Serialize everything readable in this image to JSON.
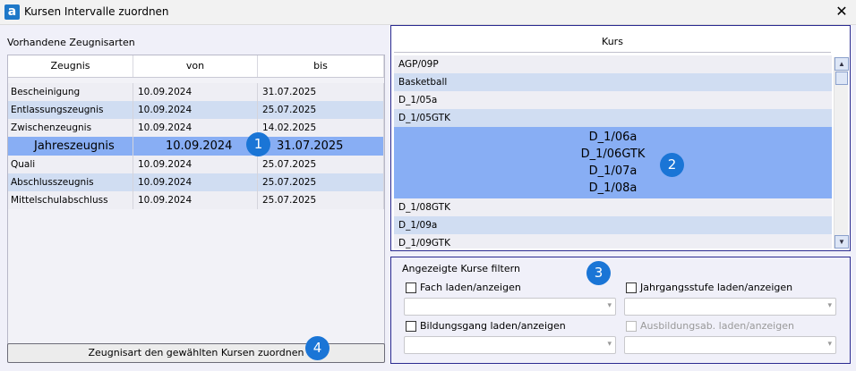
{
  "window": {
    "title": "Kursen Intervalle zuordnen",
    "icon_letter": "a"
  },
  "left": {
    "label": "Vorhandene Zeugnisarten",
    "columns": [
      "Zeugnis",
      "von",
      "bis"
    ],
    "rows": [
      {
        "zeugnis": "Bescheinigung",
        "von": "10.09.2024",
        "bis": "31.07.2025"
      },
      {
        "zeugnis": "Entlassungszeugnis",
        "von": "10.09.2024",
        "bis": "25.07.2025"
      },
      {
        "zeugnis": "Zwischenzeugnis",
        "von": "10.09.2024",
        "bis": "14.02.2025"
      },
      {
        "zeugnis": "Jahreszeugnis",
        "von": "10.09.2024",
        "bis": "31.07.2025",
        "selected": true
      },
      {
        "zeugnis": "Quali",
        "von": "10.09.2024",
        "bis": "25.07.2025"
      },
      {
        "zeugnis": "Abschlusszeugnis",
        "von": "10.09.2024",
        "bis": "25.07.2025"
      },
      {
        "zeugnis": "Mittelschulabschluss",
        "von": "10.09.2024",
        "bis": "25.07.2025"
      }
    ],
    "assign_button": "Zeugnisart den gewählten Kursen zuordnen"
  },
  "kurs": {
    "header": "Kurs",
    "items_before": [
      "AGP/09P",
      "Basketball",
      "D_1/05a",
      "D_1/05GTK"
    ],
    "selected_items": [
      "D_1/06a",
      "D_1/06GTK",
      "D_1/07a",
      "D_1/08a"
    ],
    "items_after": [
      "D_1/08GTK",
      "D_1/09a",
      "D_1/09GTK"
    ]
  },
  "filter": {
    "title": "Angezeigte Kurse filtern",
    "fach": "Fach laden/anzeigen",
    "jahrgang": "Jahrgangsstufe laden/anzeigen",
    "bildungsgang": "Bildungsgang laden/anzeigen",
    "ausbildung": "Ausbildungsab. laden/anzeigen"
  },
  "badges": [
    "1",
    "2",
    "3",
    "4"
  ],
  "colors": {
    "selection": "#88aef4",
    "stripe": "#d0ddf2",
    "badge": "#1a75d6",
    "panel_border": "#2a2a90"
  }
}
